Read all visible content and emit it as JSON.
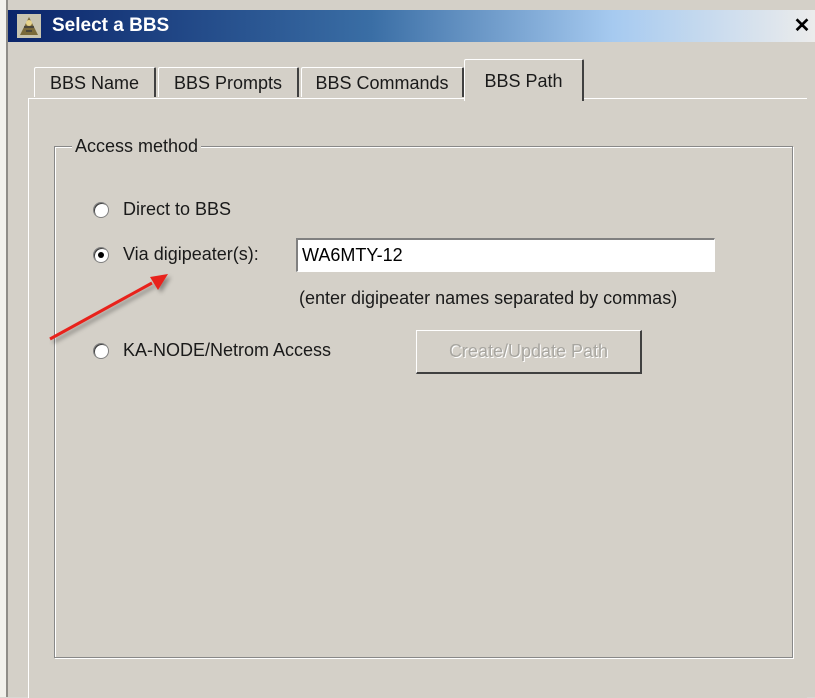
{
  "window": {
    "title": "Select a BBS",
    "close_glyph": "✕"
  },
  "tabs": [
    {
      "label": "BBS Name",
      "active": false
    },
    {
      "label": "BBS Prompts",
      "active": false
    },
    {
      "label": "BBS Commands",
      "active": false
    },
    {
      "label": "BBS Path",
      "active": true
    }
  ],
  "access": {
    "legend": "Access method",
    "options": [
      {
        "label": "Direct to BBS",
        "selected": false
      },
      {
        "label": "Via digipeater(s):",
        "selected": true
      },
      {
        "label": "KA-NODE/Netrom Access",
        "selected": false
      }
    ],
    "digipeater_value": "WA6MTY-12",
    "digipeater_hint": "(enter digipeater names separated by commas)",
    "create_button_label": "Create/Update Path",
    "create_button_enabled": false
  },
  "annotation": {
    "arrow_color": "#e8221b"
  },
  "colors": {
    "title_start": "#0a246a",
    "title_end": "#a6caf0",
    "face": "#d4d0c8"
  }
}
